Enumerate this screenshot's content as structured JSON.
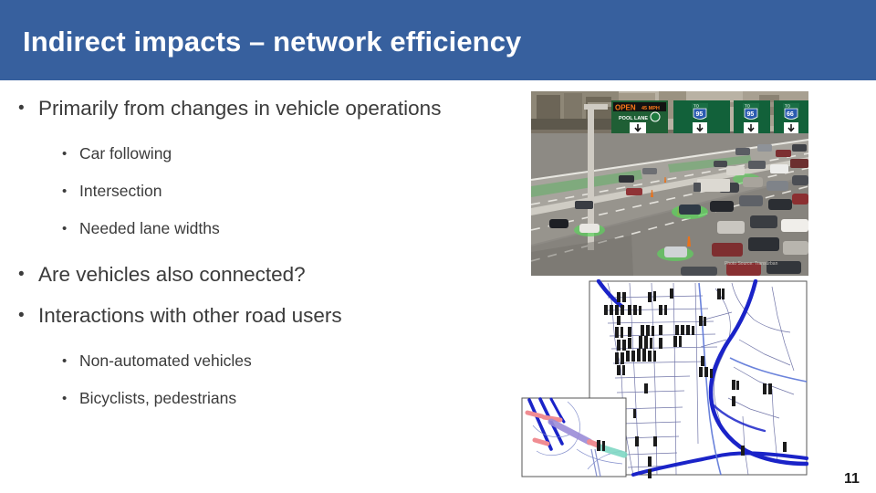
{
  "slide": {
    "title": "Indirect impacts – network efficiency",
    "page_number": "11",
    "title_band_color": "#37609e",
    "body_text_color": "#3b3b3b",
    "background_color": "#ffffff"
  },
  "bullets": [
    {
      "level": 1,
      "marker": "•",
      "text": "Primarily from changes in vehicle operations"
    },
    {
      "level": 2,
      "marker": "•",
      "text": "Car following"
    },
    {
      "level": 2,
      "marker": "•",
      "text": "Intersection"
    },
    {
      "level": 2,
      "marker": "•",
      "text": "Needed lane widths"
    },
    {
      "level": 1,
      "marker": "•",
      "text": "Are vehicles also connected?"
    },
    {
      "level": 1,
      "marker": "•",
      "text": "Interactions with other road users"
    },
    {
      "level": 2,
      "marker": "•",
      "text": "Non-automated vehicles"
    },
    {
      "level": 2,
      "marker": "•",
      "text": "Bicyclists, pedestrians"
    }
  ],
  "images": {
    "highway_photo": {
      "name": "highway-traffic-photo",
      "description": "Aerial view of a multi-lane urban freeway with express lanes, overhead green guide signs and heavy traffic",
      "signs": [
        {
          "type": "hov-status-sign",
          "headline": "OPEN",
          "speed": "45 MPH",
          "subtext": "POOL LANE"
        },
        {
          "type": "interstate-guide-sign",
          "route_shield": "95",
          "route_prefix": "TO"
        },
        {
          "type": "interstate-guide-sign",
          "route_shield": "95",
          "route_prefix": "TO"
        },
        {
          "type": "interstate-guide-sign",
          "route_shield": "66",
          "route_prefix": "TO"
        }
      ],
      "credit": "Photo Source: Transurban"
    },
    "network_map": {
      "name": "traffic-network-map",
      "description": "Transportation network model map showing roadway links in blue with signalized intersection markers, plus an inset detail of a highway interchange with colored link segments",
      "inset": {
        "name": "interchange-inset",
        "description": "Zoomed interchange detail with pink, purple and teal coded links"
      }
    }
  }
}
